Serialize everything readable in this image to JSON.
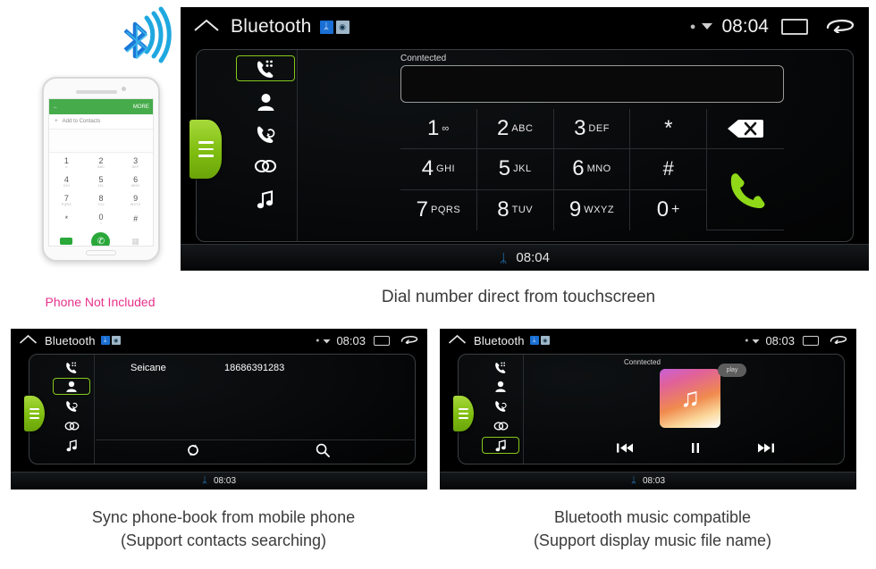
{
  "hero": {
    "bt_logo_name": "bluetooth-wireless-logo",
    "phone": {
      "appbar_back": "←",
      "appbar_more": "MORE",
      "add_contact": "Add to Contacts",
      "keys": [
        {
          "num": "1",
          "sub": "∞"
        },
        {
          "num": "2",
          "sub": "ABC"
        },
        {
          "num": "3",
          "sub": "DEF"
        },
        {
          "num": "4",
          "sub": "GHI"
        },
        {
          "num": "5",
          "sub": "JKL"
        },
        {
          "num": "6",
          "sub": "MNO"
        },
        {
          "num": "7",
          "sub": "PQRS"
        },
        {
          "num": "8",
          "sub": "TUV"
        },
        {
          "num": "9",
          "sub": "WXYZ"
        },
        {
          "num": "*",
          "sub": ""
        },
        {
          "num": "0",
          "sub": "+"
        },
        {
          "num": "#",
          "sub": ""
        }
      ],
      "call_glyph": "✆",
      "not_included": "Phone Not Included",
      "not_included_color": "#e8318b"
    }
  },
  "main_unit": {
    "status": {
      "home_icon": "home-icon",
      "title": "Bluetooth",
      "bt_badge": "ᛦ",
      "cam_badge": "◉",
      "pin_icon": "location-pin-icon",
      "wifi_icon": "wifi-icon",
      "time": "08:04",
      "recents_icon": "recents-icon",
      "back_icon": "back-arrow-icon"
    },
    "rail": [
      {
        "name": "dialpad",
        "glyph": "✆",
        "active": true
      },
      {
        "name": "contacts",
        "glyph": "♟",
        "active": false
      },
      {
        "name": "call-history",
        "glyph": "✆",
        "active": false
      },
      {
        "name": "pairing",
        "glyph": "⚭",
        "active": false
      },
      {
        "name": "music",
        "glyph": "♫",
        "active": false
      }
    ],
    "tab_handle": "menu-tab-handle",
    "connected_label": "Conntected",
    "dial_value": "",
    "keypad": [
      {
        "num": "1",
        "sub": "∞",
        "name": "key-1"
      },
      {
        "num": "2",
        "sub": "ABC",
        "name": "key-2"
      },
      {
        "num": "3",
        "sub": "DEF",
        "name": "key-3"
      },
      {
        "num": "*",
        "sub": "",
        "name": "key-star"
      },
      {
        "num": "⌫",
        "sub": "",
        "name": "backspace"
      },
      {
        "num": "4",
        "sub": "GHI",
        "name": "key-4"
      },
      {
        "num": "5",
        "sub": "JKL",
        "name": "key-5"
      },
      {
        "num": "6",
        "sub": "MNO",
        "name": "key-6"
      },
      {
        "num": "#",
        "sub": "",
        "name": "key-hash"
      },
      {
        "num": "✆",
        "sub": "",
        "name": "call"
      },
      {
        "num": "7",
        "sub": "PQRS",
        "name": "key-7"
      },
      {
        "num": "8",
        "sub": "TUV",
        "name": "key-8"
      },
      {
        "num": "9",
        "sub": "WXYZ",
        "name": "key-9"
      },
      {
        "num": "0",
        "sub": "+",
        "name": "key-0"
      }
    ],
    "bottom": {
      "bt": "ᛦ",
      "time": "08:04"
    },
    "caption": "Dial number direct from touchscreen"
  },
  "phonebook_unit": {
    "status": {
      "title": "Bluetooth",
      "time": "08:03",
      "bt_badge": "ᛦ",
      "cam_badge": "◉"
    },
    "rail_active": "contacts",
    "contact": {
      "name": "Seicane",
      "number": "18686391283"
    },
    "tools": {
      "sync": "sync-icon",
      "search": "search-icon"
    },
    "bottom": {
      "bt": "ᛦ",
      "time": "08:03"
    },
    "caption_line1": "Sync phone-book from mobile phone",
    "caption_line2": "(Support contacts searching)"
  },
  "music_unit": {
    "status": {
      "title": "Bluetooth",
      "time": "08:03",
      "bt_badge": "ᛦ",
      "cam_badge": "◉"
    },
    "rail_active": "music",
    "connected_label": "Conntected",
    "album_note": "♫",
    "play_chip": "play",
    "transport": {
      "prev": "⏮",
      "pause": "⏸",
      "next": "⏭"
    },
    "bottom": {
      "bt": "ᛦ",
      "time": "08:03"
    },
    "caption_line1": "Bluetooth music compatible",
    "caption_line2": "(Support display music file name)"
  },
  "colors": {
    "accent_green": "#86c91b",
    "bt_blue": "#2b8fe0",
    "pink": "#e8318b"
  }
}
